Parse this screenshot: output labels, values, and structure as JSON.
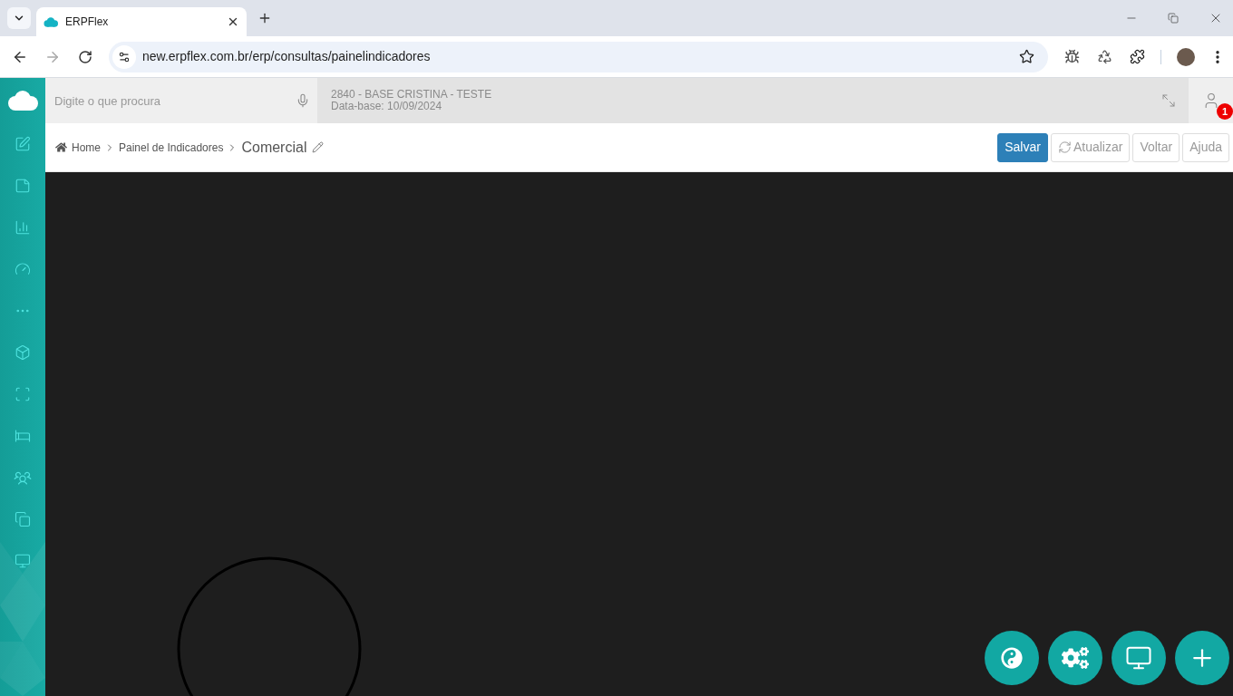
{
  "browser": {
    "tab": {
      "title": "ERPFlex"
    },
    "url": "new.erpflex.com.br/erp/consultas/painelindicadores"
  },
  "search": {
    "placeholder": "Digite o que procura"
  },
  "company": {
    "name": "2840 - BASE CRISTINA - TESTE",
    "date": "Data-base: 10/09/2024"
  },
  "notifications": {
    "count": "1"
  },
  "breadcrumb": [
    {
      "label": "Home",
      "current": false
    },
    {
      "label": "Painel de Indicadores",
      "current": false
    },
    {
      "label": "Comercial",
      "current": true
    }
  ],
  "actions": [
    {
      "label": "Salvar",
      "kind": "primary"
    },
    {
      "label": "Atualizar",
      "kind": "refresh"
    },
    {
      "label": "Voltar",
      "kind": "default"
    },
    {
      "label": "Ajuda",
      "kind": "default"
    }
  ]
}
